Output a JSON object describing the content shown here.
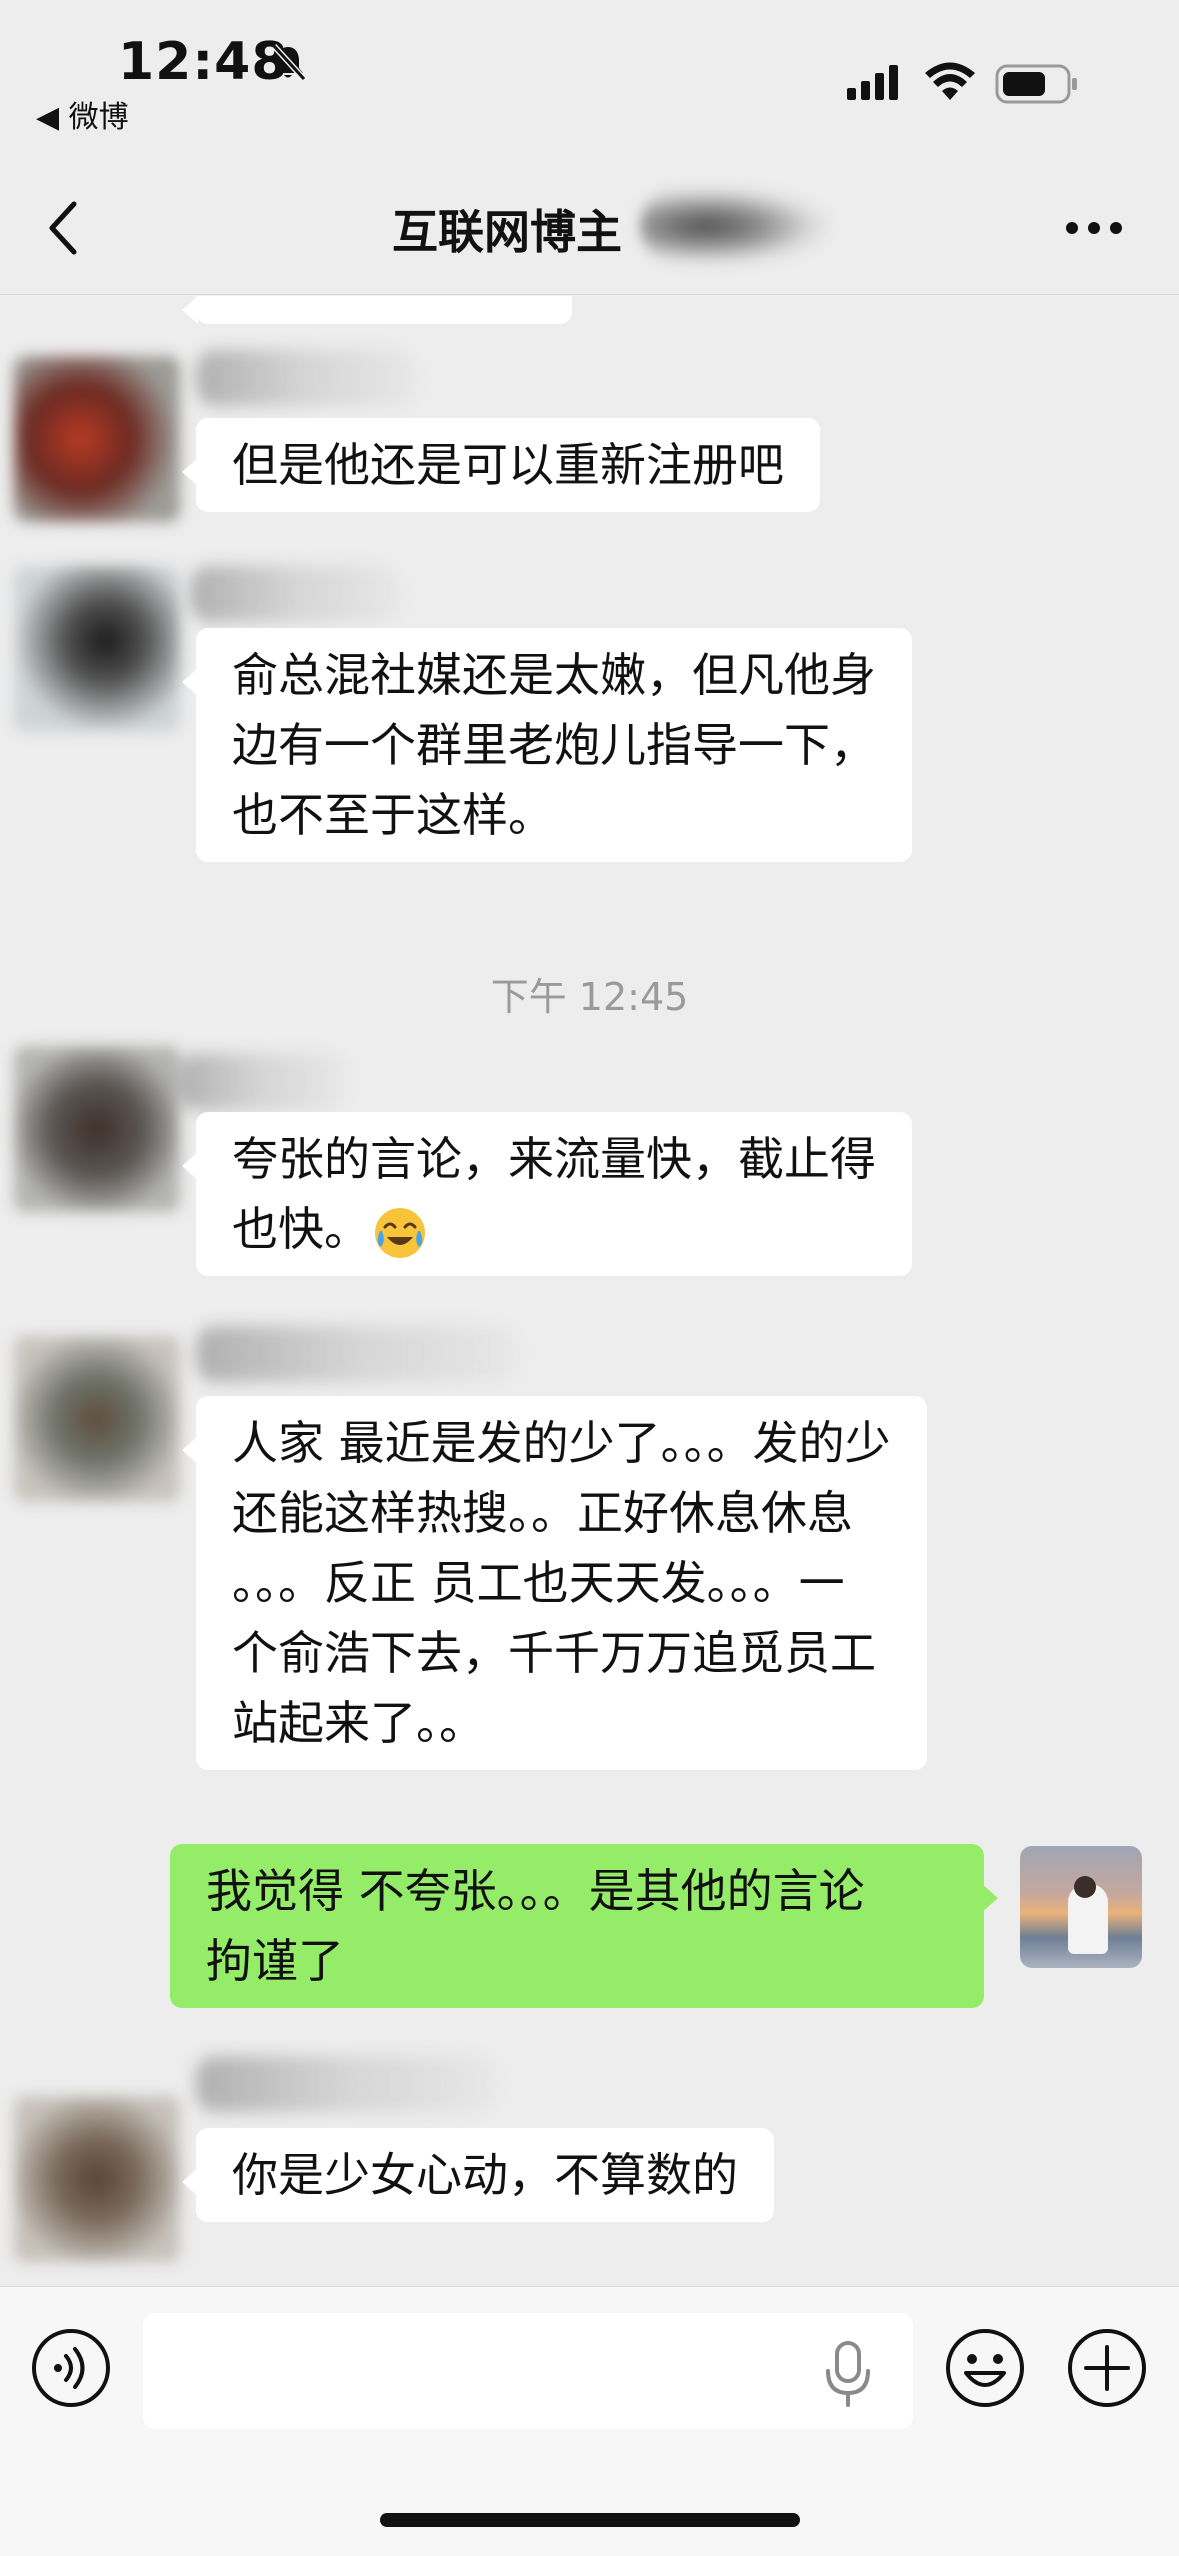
{
  "status_bar": {
    "time": "12:48",
    "back_app": "◀ 微博",
    "icons": [
      "bell-slash-icon",
      "cellular-signal-icon",
      "wifi-icon",
      "battery-icon"
    ]
  },
  "nav": {
    "title": "互联网博主",
    "icons": [
      "chevron-left-icon",
      "more-icon"
    ]
  },
  "messages": [
    {
      "side": "left",
      "lines": [
        "但是他还是可以重新注册吧"
      ]
    },
    {
      "side": "left",
      "lines": [
        "俞总混社媒还是太嫩，但凡他身",
        "边有一个群里老炮儿指导一下，",
        "也不至于这样。"
      ]
    },
    {
      "type": "timestamp",
      "text": "下午 12:45"
    },
    {
      "side": "left",
      "lines": [
        "夸张的言论，来流量快，截止得",
        "也快。"
      ],
      "emoji": "crying-laughing-emoji"
    },
    {
      "side": "left",
      "lines": [
        "人家 最近是发的少了。。。发的少",
        "还能这样热搜。。正好休息休息",
        "。。。反正 员工也天天发。。。一",
        "个俞浩下去，千千万万追觅员工",
        "站起来了。。"
      ]
    },
    {
      "side": "right",
      "lines": [
        "我觉得 不夸张。。。是其他的言论",
        "拘谨了"
      ]
    },
    {
      "side": "left",
      "lines": [
        "你是少女心动，不算数的"
      ]
    }
  ],
  "input_bar": {
    "value": "",
    "icons": [
      "voice-icon",
      "microphone-icon",
      "emoji-icon",
      "plus-icon"
    ]
  },
  "colors": {
    "background": "#ededed",
    "bubble_incoming": "#ffffff",
    "bubble_outgoing": "#95ec69",
    "timestamp": "#9a9a9a"
  }
}
